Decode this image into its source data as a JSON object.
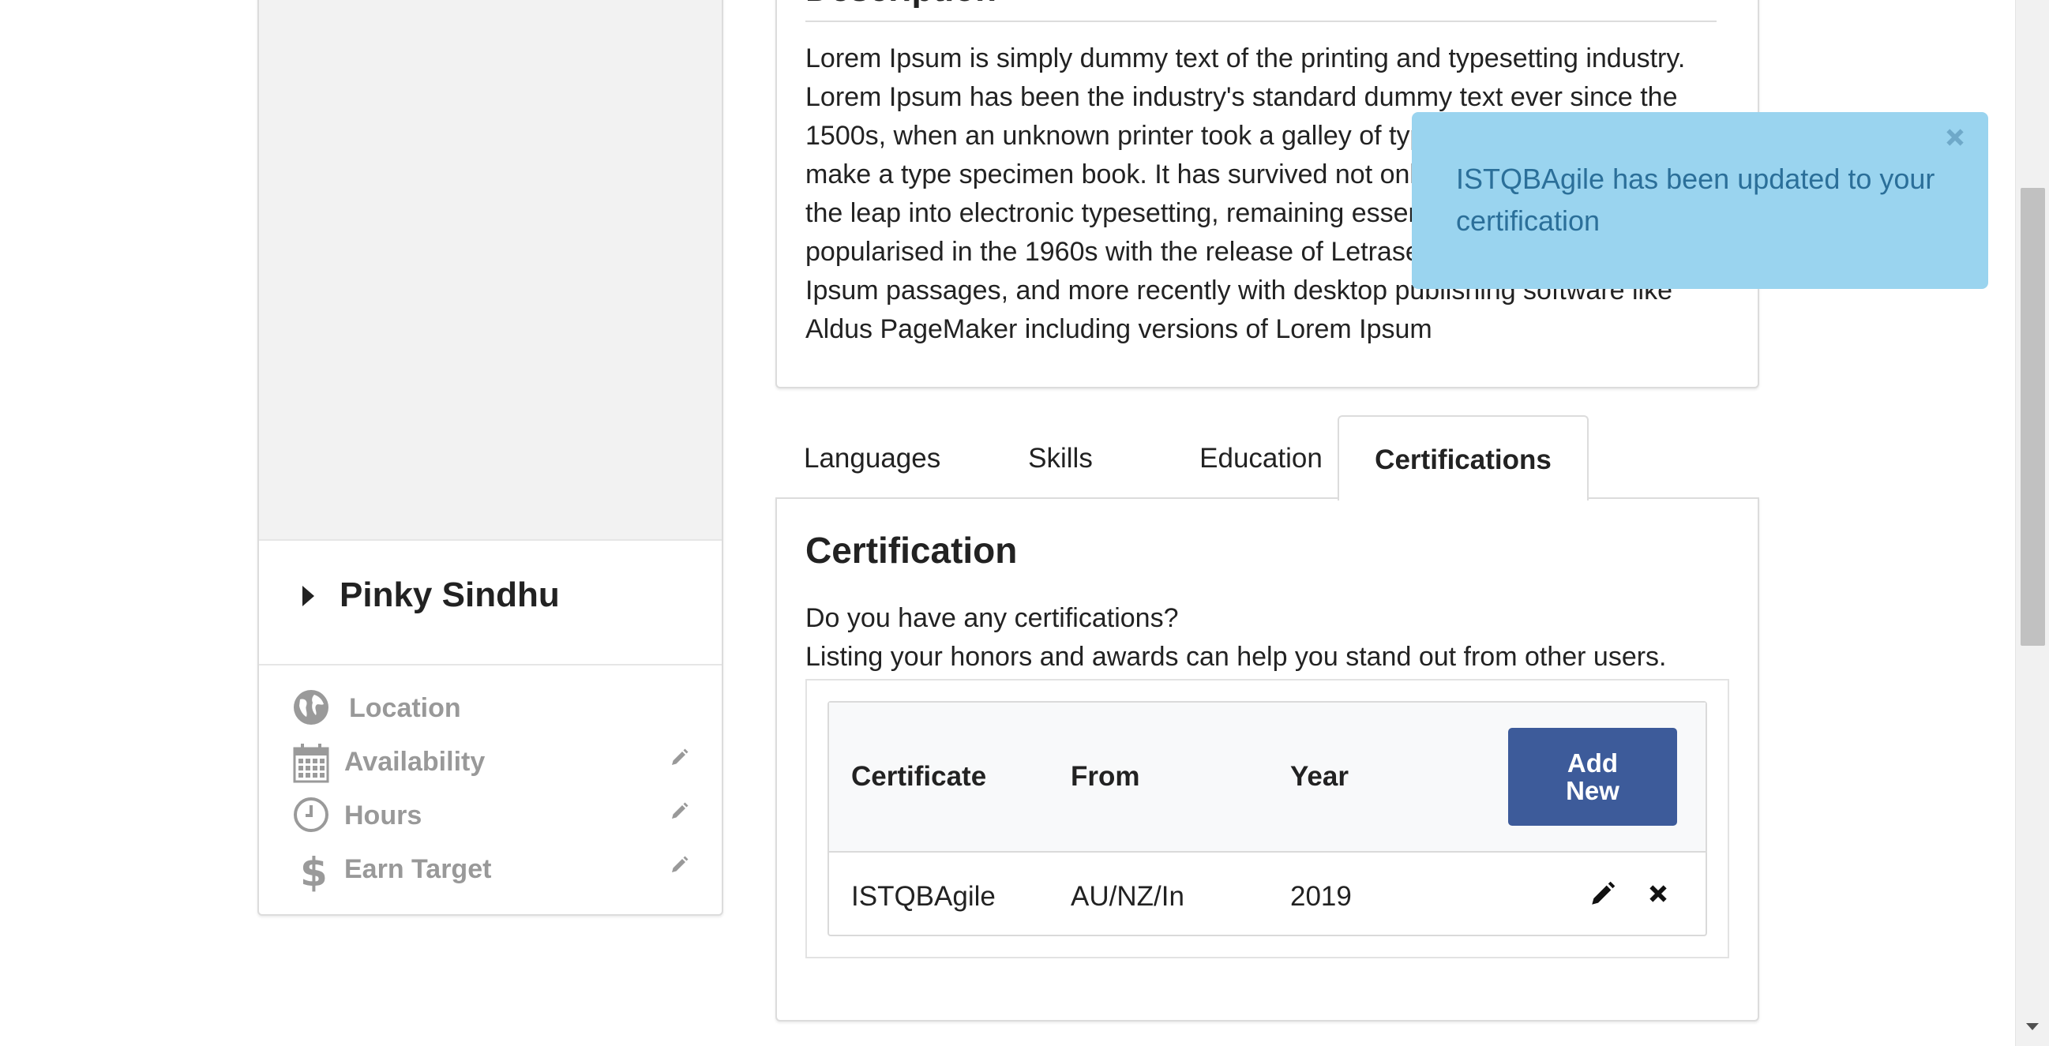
{
  "profile": {
    "name": "Pinky Sindhu",
    "meta": [
      {
        "label": "Location",
        "icon": "globe-icon",
        "editable": false
      },
      {
        "label": "Availability",
        "icon": "calendar-icon",
        "editable": true
      },
      {
        "label": "Hours",
        "icon": "clock-icon",
        "editable": true
      },
      {
        "label": "Earn Target",
        "icon": "dollar-icon",
        "editable": true
      }
    ]
  },
  "description": {
    "title": "Description",
    "text": "Lorem Ipsum is simply dummy text of the printing and typesetting industry. Lorem Ipsum has been the industry's standard dummy text ever since the 1500s, when an unknown printer took a galley of type and scrambled it to make a type specimen book. It has survived not only five centuries, but also the leap into electronic typesetting, remaining essentially unchanged. It was popularised in the 1960s with the release of Letraset sheets containing Lorem Ipsum passages, and more recently with desktop publishing software like Aldus PageMaker including versions of Lorem Ipsum"
  },
  "tabs": [
    {
      "label": "Languages",
      "active": false
    },
    {
      "label": "Skills",
      "active": false
    },
    {
      "label": "Education",
      "active": false
    },
    {
      "label": "Certifications",
      "active": true
    }
  ],
  "certification": {
    "title": "Certification",
    "question": "Do you have any certifications?",
    "hint": "Listing your honors and awards can help you stand out from other users.",
    "columns": [
      "Certificate",
      "From",
      "Year"
    ],
    "add_button": "Add New",
    "rows": [
      {
        "certificate": "ISTQBAgile",
        "from": "AU/NZ/In",
        "year": "2019"
      }
    ]
  },
  "toast": {
    "message": "ISTQBAgile has been updated to your certification"
  },
  "colors": {
    "primary_button": "#3d5b9a",
    "toast_bg": "#9ad4ef",
    "toast_text": "#2b6f99"
  }
}
